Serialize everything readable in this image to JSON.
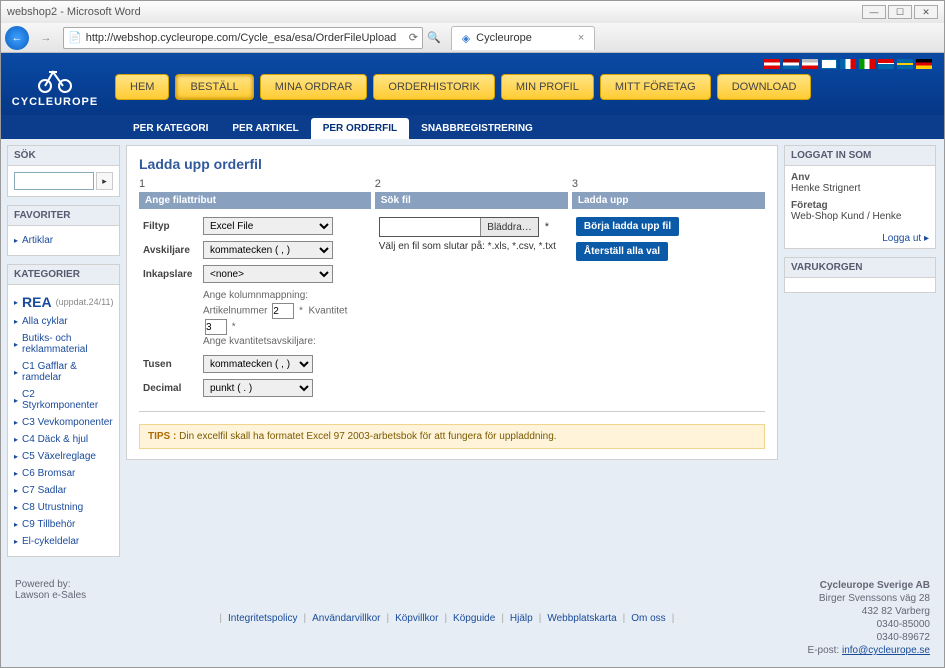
{
  "browser": {
    "outer_title": "webshop2 - Microsoft Word",
    "url": "http://webshop.cycleurope.com/Cycle_esa/esa/OrderFileUpload",
    "tab_title": "Cycleurope"
  },
  "logo_text": "CYCLEUROPE",
  "main_nav": [
    "HEM",
    "BESTÄLL",
    "MINA ORDRAR",
    "ORDERHISTORIK",
    "MIN PROFIL",
    "MITT FÖRETAG",
    "DOWNLOAD"
  ],
  "main_nav_active_index": 1,
  "sub_nav": [
    "PER KATEGORI",
    "PER ARTIKEL",
    "PER ORDERFIL",
    "SNABBREGISTRERING"
  ],
  "sub_nav_active_index": 2,
  "left": {
    "sok_h": "SÖK",
    "fav_h": "FAVORITER",
    "fav_items": [
      "Artiklar"
    ],
    "kat_h": "KATEGORIER",
    "rea_label": "REA",
    "rea_note": "(uppdat.24/11)",
    "kat_items": [
      "Alla cyklar",
      "Butiks- och reklammaterial",
      "C1 Gafflar & ramdelar",
      "C2 Styrkomponenter",
      "C3 Vevkomponenter",
      "C4 Däck & hjul",
      "C5 Växelreglage",
      "C6 Bromsar",
      "C7 Sadlar",
      "C8 Utrustning",
      "C9 Tillbehör",
      "El-cykeldelar"
    ]
  },
  "page_title": "Ladda upp orderfil",
  "steps": {
    "s1": {
      "num": "1",
      "h": "Ange filattribut",
      "filtyp_l": "Filtyp",
      "filtyp_v": "Excel File",
      "avsk_l": "Avskiljare",
      "avsk_v": "kommatecken ( , )",
      "inkap_l": "Inkapslare",
      "inkap_v": "<none>",
      "map_l": "Ange kolumnmappning:",
      "art_l": "Artikelnummer",
      "art_v": "2",
      "kv_l": "Kvantitet",
      "kv_v": "3",
      "kvavsk_l": "Ange kvantitetsavskiljare:",
      "tusen_l": "Tusen",
      "tusen_v": "kommatecken ( , )",
      "dec_l": "Decimal",
      "dec_v": "punkt ( . )"
    },
    "s2": {
      "num": "2",
      "h": "Sök fil",
      "browse": "Bläddra…",
      "hint": "Välj en fil som slutar på: *.xls, *.csv, *.txt"
    },
    "s3": {
      "num": "3",
      "h": "Ladda upp",
      "btn1": "Börja ladda upp fil",
      "btn2": "Återställ alla val"
    }
  },
  "tip": "TIPS : Din excelfil skall ha formatet Excel 97 2003-arbetsbok för att fungera för uppladdning.",
  "right": {
    "login_h": "LOGGAT IN SOM",
    "anv_l": "Anv",
    "anv_v": "Henke Strignert",
    "for_l": "Företag",
    "for_v": "Web-Shop Kund / Henke",
    "logout": "Logga ut",
    "cart_h": "VARUKORGEN"
  },
  "footer": {
    "powered_l": "Powered by:",
    "powered_v": "Lawson e-Sales",
    "links": [
      "Integritetspolicy",
      "Användarvillkor",
      "Köpvillkor",
      "Köpguide",
      "Hjälp",
      "Webbplatskarta",
      "Om oss"
    ],
    "company": "Cycleurope Sverige AB",
    "addr1": "Birger Svenssons väg 28",
    "addr2": "432 82 Varberg",
    "tel1": "0340-85000",
    "tel2": "0340-89672",
    "email_l": "E-post:",
    "email": "info@cycleurope.se"
  }
}
